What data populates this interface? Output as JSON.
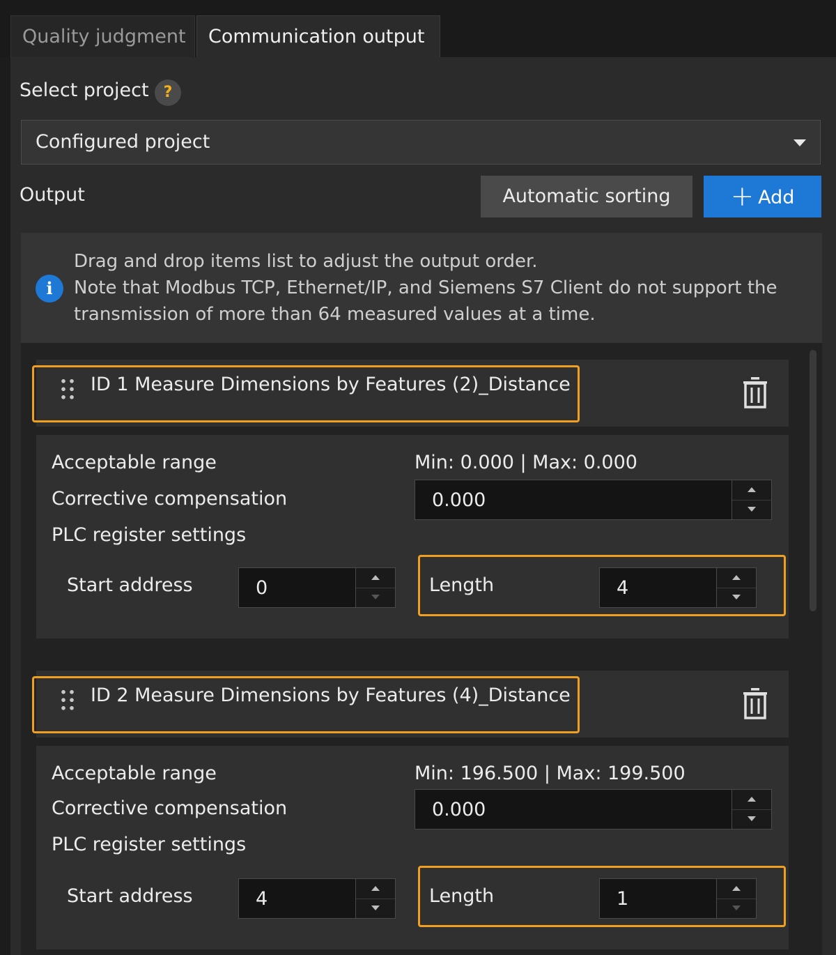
{
  "tabs": [
    {
      "label": "Quality judgment",
      "active": false
    },
    {
      "label": "Communication output",
      "active": true
    }
  ],
  "select_project": {
    "label": "Select project",
    "help_icon": "question-mark-icon",
    "value": "Configured project"
  },
  "output": {
    "label": "Output",
    "sort_button": "Automatic sorting",
    "add_button": "Add"
  },
  "info": {
    "icon": "info-icon",
    "lines": [
      "Drag and drop items list to adjust the output order.",
      "Note that Modbus TCP, Ethernet/IP, and Siemens S7 Client do not support the",
      "transmission of more than 64 measured values at a time."
    ]
  },
  "items": [
    {
      "title": "ID 1  Measure Dimensions by Features (2)_Distance",
      "acceptable_range_label": "Acceptable range",
      "acceptable_range_value": "Min: 0.000 | Max: 0.000",
      "corrective_label": "Corrective compensation",
      "corrective_value": "0.000",
      "plc_label": "PLC register settings",
      "start_label": "Start address",
      "start_value": "0",
      "length_label": "Length",
      "length_value": "4"
    },
    {
      "title": "ID 2  Measure Dimensions by Features (4)_Distance",
      "acceptable_range_label": "Acceptable range",
      "acceptable_range_value": "Min: 196.500 | Max: 199.500",
      "corrective_label": "Corrective compensation",
      "corrective_value": "0.000",
      "plc_label": "PLC register settings",
      "start_label": "Start address",
      "start_value": "4",
      "length_label": "Length",
      "length_value": "1"
    }
  ],
  "colors": {
    "accent": "#1d78d6",
    "highlight": "#f0a020",
    "help": "#f2b11e"
  }
}
